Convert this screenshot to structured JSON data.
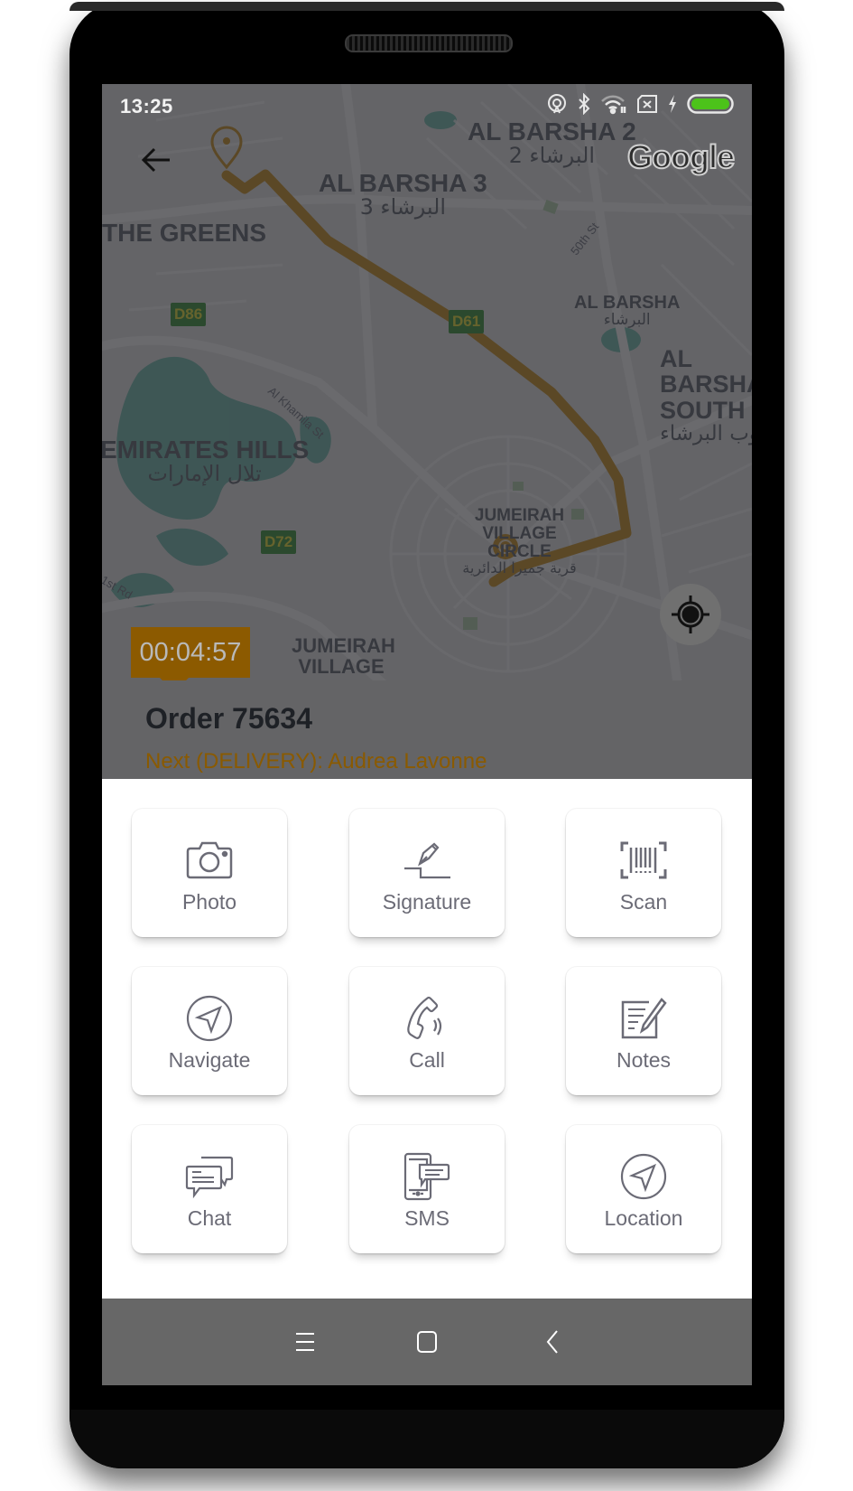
{
  "status_bar": {
    "time": "13:25",
    "icons": [
      "hotspot-icon",
      "bluetooth-icon",
      "wifi-icon",
      "no-sim-icon",
      "charging-icon",
      "battery-icon"
    ],
    "battery_color": "#4cc31a"
  },
  "map": {
    "provider_logo": "Google",
    "areas": [
      {
        "name": "AL BARSHA 2",
        "arabic": "البرشاء 2"
      },
      {
        "name": "AL BARSHA 3",
        "arabic": "البرشاء 3"
      },
      {
        "name": "THE GREENS",
        "arabic": ""
      },
      {
        "name": "AL BARSHA",
        "arabic": "البرشاء"
      },
      {
        "name": "AL BARSHA SOUTH",
        "arabic": "جنوب البرشاء"
      },
      {
        "name": "EMIRATES HILLS",
        "arabic": "تلال الإمارات"
      },
      {
        "name": "JUMEIRAH VILLAGE CIRCLE",
        "arabic": "قرية جميرا الدائرية"
      },
      {
        "name": "JUMEIRAH VILLAGE",
        "arabic": ""
      }
    ],
    "road_shields": [
      "D86",
      "D61",
      "D72"
    ],
    "streets": [
      "50th St",
      "Al Khamila St",
      "1st Rd"
    ],
    "route_color": "#8c5a00",
    "timer": "00:04:57"
  },
  "order": {
    "title": "Order 75634",
    "next_label": "Next (DELIVERY): Audrea Lavonne",
    "accent_color": "#8a5a00"
  },
  "actions": [
    {
      "label": "Photo",
      "icon": "camera-icon"
    },
    {
      "label": "Signature",
      "icon": "signature-icon"
    },
    {
      "label": "Scan",
      "icon": "barcode-scan-icon"
    },
    {
      "label": "Navigate",
      "icon": "navigate-icon"
    },
    {
      "label": "Call",
      "icon": "phone-icon"
    },
    {
      "label": "Notes",
      "icon": "notes-icon"
    },
    {
      "label": "Chat",
      "icon": "chat-icon"
    },
    {
      "label": "SMS",
      "icon": "sms-icon"
    },
    {
      "label": "Location",
      "icon": "location-arrow-icon"
    }
  ],
  "nav_bar": {
    "buttons": [
      "menu-icon",
      "home-icon",
      "back-icon"
    ]
  }
}
